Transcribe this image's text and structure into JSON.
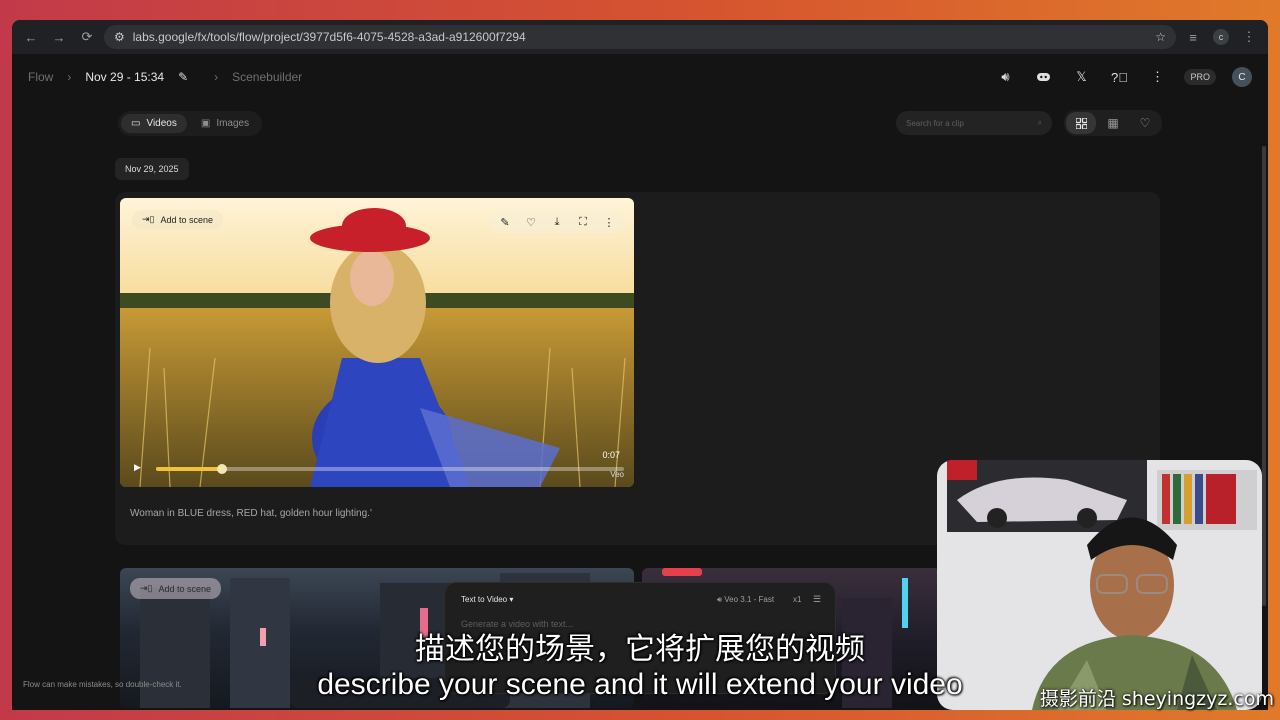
{
  "browser": {
    "url": "labs.google/fx/tools/flow/project/3977d5f6-4075-4528-a3ad-a912600f7294",
    "profile_initial": "c"
  },
  "header": {
    "app": "Flow",
    "project": "Nov 29 - 15:34",
    "section": "Scenebuilder",
    "plan_badge": "PRO",
    "avatar_initial": "C"
  },
  "toolbar": {
    "tabs": [
      {
        "label": "Videos",
        "icon": "video-icon",
        "active": true
      },
      {
        "label": "Images",
        "icon": "image-icon",
        "active": false
      }
    ],
    "search_placeholder": "Search for a clip",
    "views": [
      "grid-view-icon",
      "list-view-icon",
      "favorites-heart-icon"
    ]
  },
  "date_group": "Nov 29, 2025",
  "clip": {
    "add_to_scene": "Add to scene",
    "duration": "0:07",
    "model_tag": "Veo",
    "progress_fraction": 0.14,
    "caption": "Woman in BLUE dress, RED hat, golden hour lighting.'"
  },
  "clip2": {
    "add_to_scene": "Add to scene"
  },
  "composer": {
    "mode": "Text to Video",
    "model": "Veo 3.1 - Fast",
    "count": "x1",
    "prompt_placeholder": "Generate a video with text..."
  },
  "disclaimer": "Flow can make mistakes, so double-check it.",
  "subtitles": {
    "zh": "描述您的场景，它将扩展您的视频",
    "en": "describe your scene and it will extend your video"
  },
  "watermark": "摄影前沿 sheyingzyz.com",
  "colors": {
    "accent_yellow": "#f0c43a",
    "page_bg": "#141414"
  }
}
